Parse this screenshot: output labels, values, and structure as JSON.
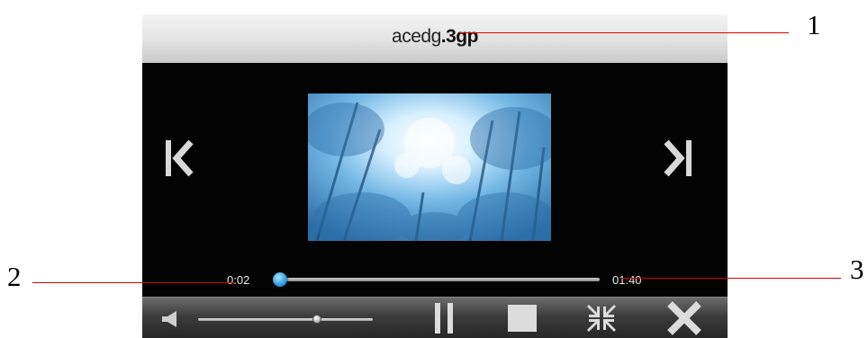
{
  "player": {
    "title_base": "acedg",
    "title_ext": ".3gp",
    "time_current": "0:02",
    "time_total": "01:40",
    "seek_progress": 0.02,
    "volume_level": 0.68
  },
  "controls": {
    "prev_icon": "skip-previous-icon",
    "next_icon": "skip-next-icon",
    "volume_icon": "speaker-icon",
    "pause_icon": "pause-icon",
    "stop_icon": "stop-icon",
    "fullscreen_icon": "collapse-arrows-icon",
    "close_icon": "close-x-icon"
  },
  "annotations": {
    "label_1": "1",
    "label_2": "2",
    "label_3": "3"
  },
  "colors": {
    "accent": "#4fb3e8",
    "callout_line": "#d40000"
  }
}
